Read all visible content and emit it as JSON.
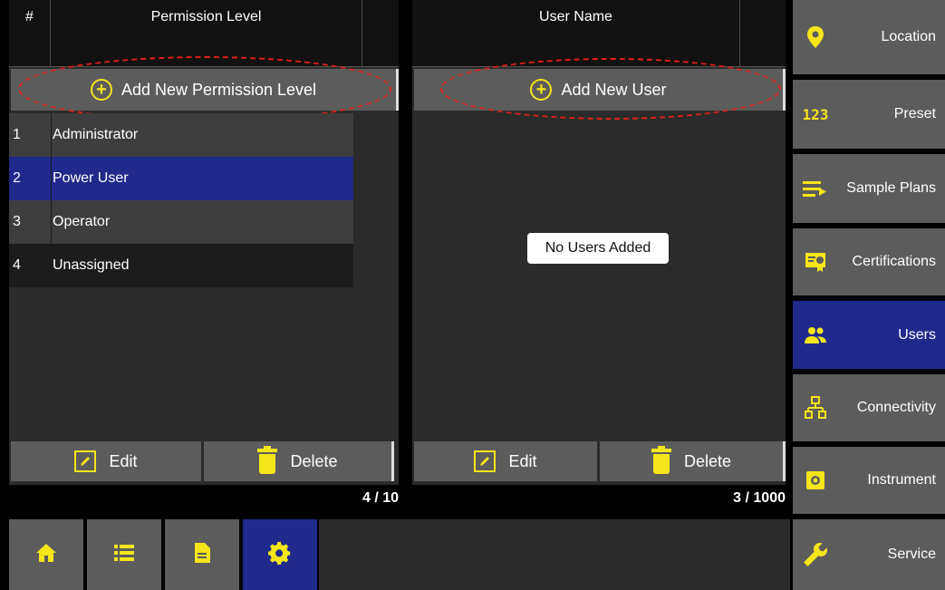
{
  "permissions_panel": {
    "col_num": "#",
    "col_title": "Permission Level",
    "add_label": "Add New Permission Level",
    "rows": [
      {
        "num": "1",
        "label": "Administrator"
      },
      {
        "num": "2",
        "label": "Power User"
      },
      {
        "num": "3",
        "label": "Operator"
      },
      {
        "num": "4",
        "label": "Unassigned"
      }
    ],
    "selected_row": 2,
    "edit_label": "Edit",
    "delete_label": "Delete",
    "counter": "4 / 10"
  },
  "users_panel": {
    "col_title": "User Name",
    "add_label": "Add New User",
    "empty_message": "No Users Added",
    "edit_label": "Edit",
    "delete_label": "Delete",
    "counter": "3 / 1000"
  },
  "sidebar": {
    "items": [
      {
        "label": "Location",
        "icon": "location-pin-icon"
      },
      {
        "label": "Preset",
        "icon": "123-icon"
      },
      {
        "label": "Sample Plans",
        "icon": "list-arrow-icon"
      },
      {
        "label": "Certifications",
        "icon": "certificate-icon"
      },
      {
        "label": "Users",
        "icon": "users-icon",
        "active": true
      },
      {
        "label": "Connectivity",
        "icon": "network-icon"
      },
      {
        "label": "Instrument",
        "icon": "instrument-icon"
      },
      {
        "label": "Service",
        "icon": "wrench-icon"
      }
    ],
    "preset_icon_text": "123"
  },
  "bottom_nav": {
    "items": [
      {
        "icon": "home-icon"
      },
      {
        "icon": "list-icon"
      },
      {
        "icon": "document-icon"
      },
      {
        "icon": "gear-icon",
        "active": true
      }
    ]
  },
  "colors": {
    "accent_yellow": "#f5e51b",
    "active_blue": "#1f2a8c",
    "annotation_red": "#e0201b",
    "button_gray": "#5c5c5c"
  }
}
